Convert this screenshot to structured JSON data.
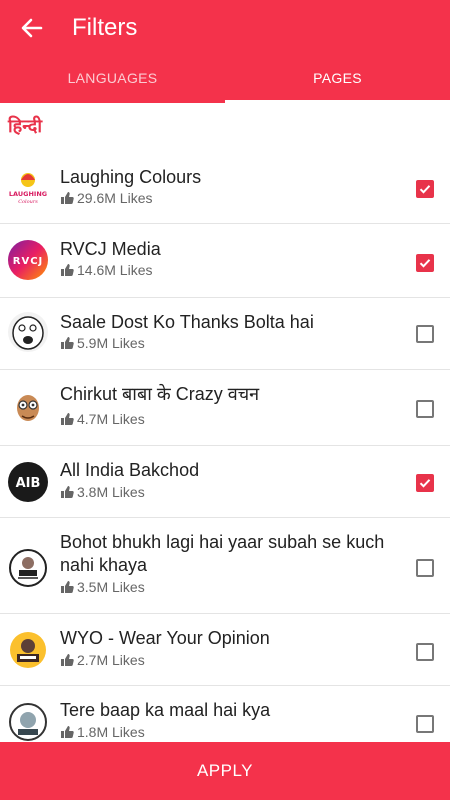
{
  "header": {
    "title": "Filters"
  },
  "tabs": [
    {
      "label": "LANGUAGES",
      "active": false
    },
    {
      "label": "PAGES",
      "active": true
    }
  ],
  "section": {
    "heading": "हिन्दी"
  },
  "pages": [
    {
      "name": "Laughing Colours",
      "likes": "29.6M Likes",
      "checked": true
    },
    {
      "name": "RVCJ Media",
      "likes": "14.6M Likes",
      "checked": true
    },
    {
      "name": "Saale Dost Ko Thanks Bolta hai",
      "likes": "5.9M Likes",
      "checked": false
    },
    {
      "name": "Chirkut बाबा के Crazy वचन",
      "likes": "4.7M Likes",
      "checked": false
    },
    {
      "name": "All India Bakchod",
      "likes": "3.8M Likes",
      "checked": true
    },
    {
      "name": "Bohot bhukh lagi hai yaar subah se kuch nahi khaya",
      "likes": "3.5M Likes",
      "checked": false
    },
    {
      "name": "WYO - Wear Your Opinion",
      "likes": "2.7M Likes",
      "checked": false
    },
    {
      "name": "Tere baap ka maal hai kya",
      "likes": "1.8M Likes",
      "checked": false
    }
  ],
  "avatars": {
    "laughing_colours_logo": "LAUGHING",
    "rvcj_logo": "RVCJ",
    "aib_logo": "AIB"
  },
  "footer": {
    "apply_label": "APPLY"
  },
  "colors": {
    "primary": "#f4324b",
    "accent": "#e8334a"
  }
}
